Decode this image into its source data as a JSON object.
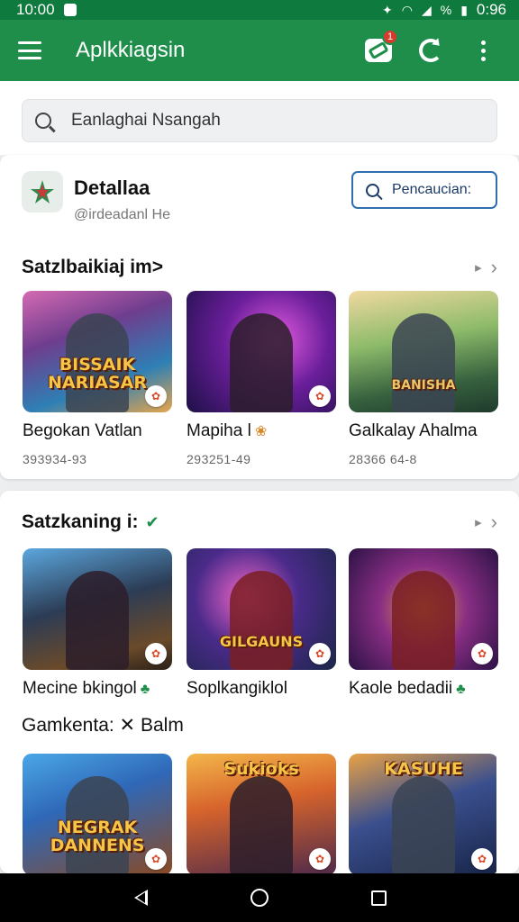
{
  "status_bar": {
    "time": "10:00",
    "right_text": "0:96",
    "battery_label": "%"
  },
  "app_bar": {
    "title": "Aplkkiagsin",
    "badge_count": "1"
  },
  "search": {
    "placeholder": "Eanlaghai Nsangah"
  },
  "developer": {
    "name": "Detallaa",
    "handle": "@irdeadanl He",
    "search_button_label": "Pencaucian:"
  },
  "section_1": {
    "title": "Satzlbaikiaj im>",
    "more_label": "▸",
    "items": [
      {
        "name": "Begokan Vatlan",
        "sub": "393934-93",
        "art_text": "BISSAIK NARIASAR",
        "corner_icon": "✿"
      },
      {
        "name": "Mapiha l",
        "mark": "❀",
        "sub": "293251-49",
        "art_text": "",
        "corner_icon": "✿"
      },
      {
        "name": "Galkalay Ahalma",
        "sub": "28366 64-8",
        "art_text": "BANISHA",
        "corner_icon": "✿"
      }
    ]
  },
  "section_2": {
    "title": "Satzkaning i:",
    "check": "✔",
    "more_label": "▸",
    "items": [
      {
        "name": "Mecine bkingol",
        "mark": "♣",
        "art_text": "",
        "corner_icon": "✿"
      },
      {
        "name": "Soplkangiklol",
        "mark": "",
        "art_text": "GILGAUNS",
        "corner_icon": "✿"
      },
      {
        "name": "Kaole bedadii",
        "mark": "♣",
        "art_text": "",
        "corner_icon": "✿"
      }
    ]
  },
  "section_3": {
    "title": "Gamkenta: ✕ Balm",
    "items": [
      {
        "art_text": "NEGRAK DANNENS",
        "corner_icon": "✿"
      },
      {
        "art_text": "Sukioks",
        "corner_icon": "✿"
      },
      {
        "art_text": "KASUHE",
        "corner_icon": "✿"
      }
    ]
  }
}
